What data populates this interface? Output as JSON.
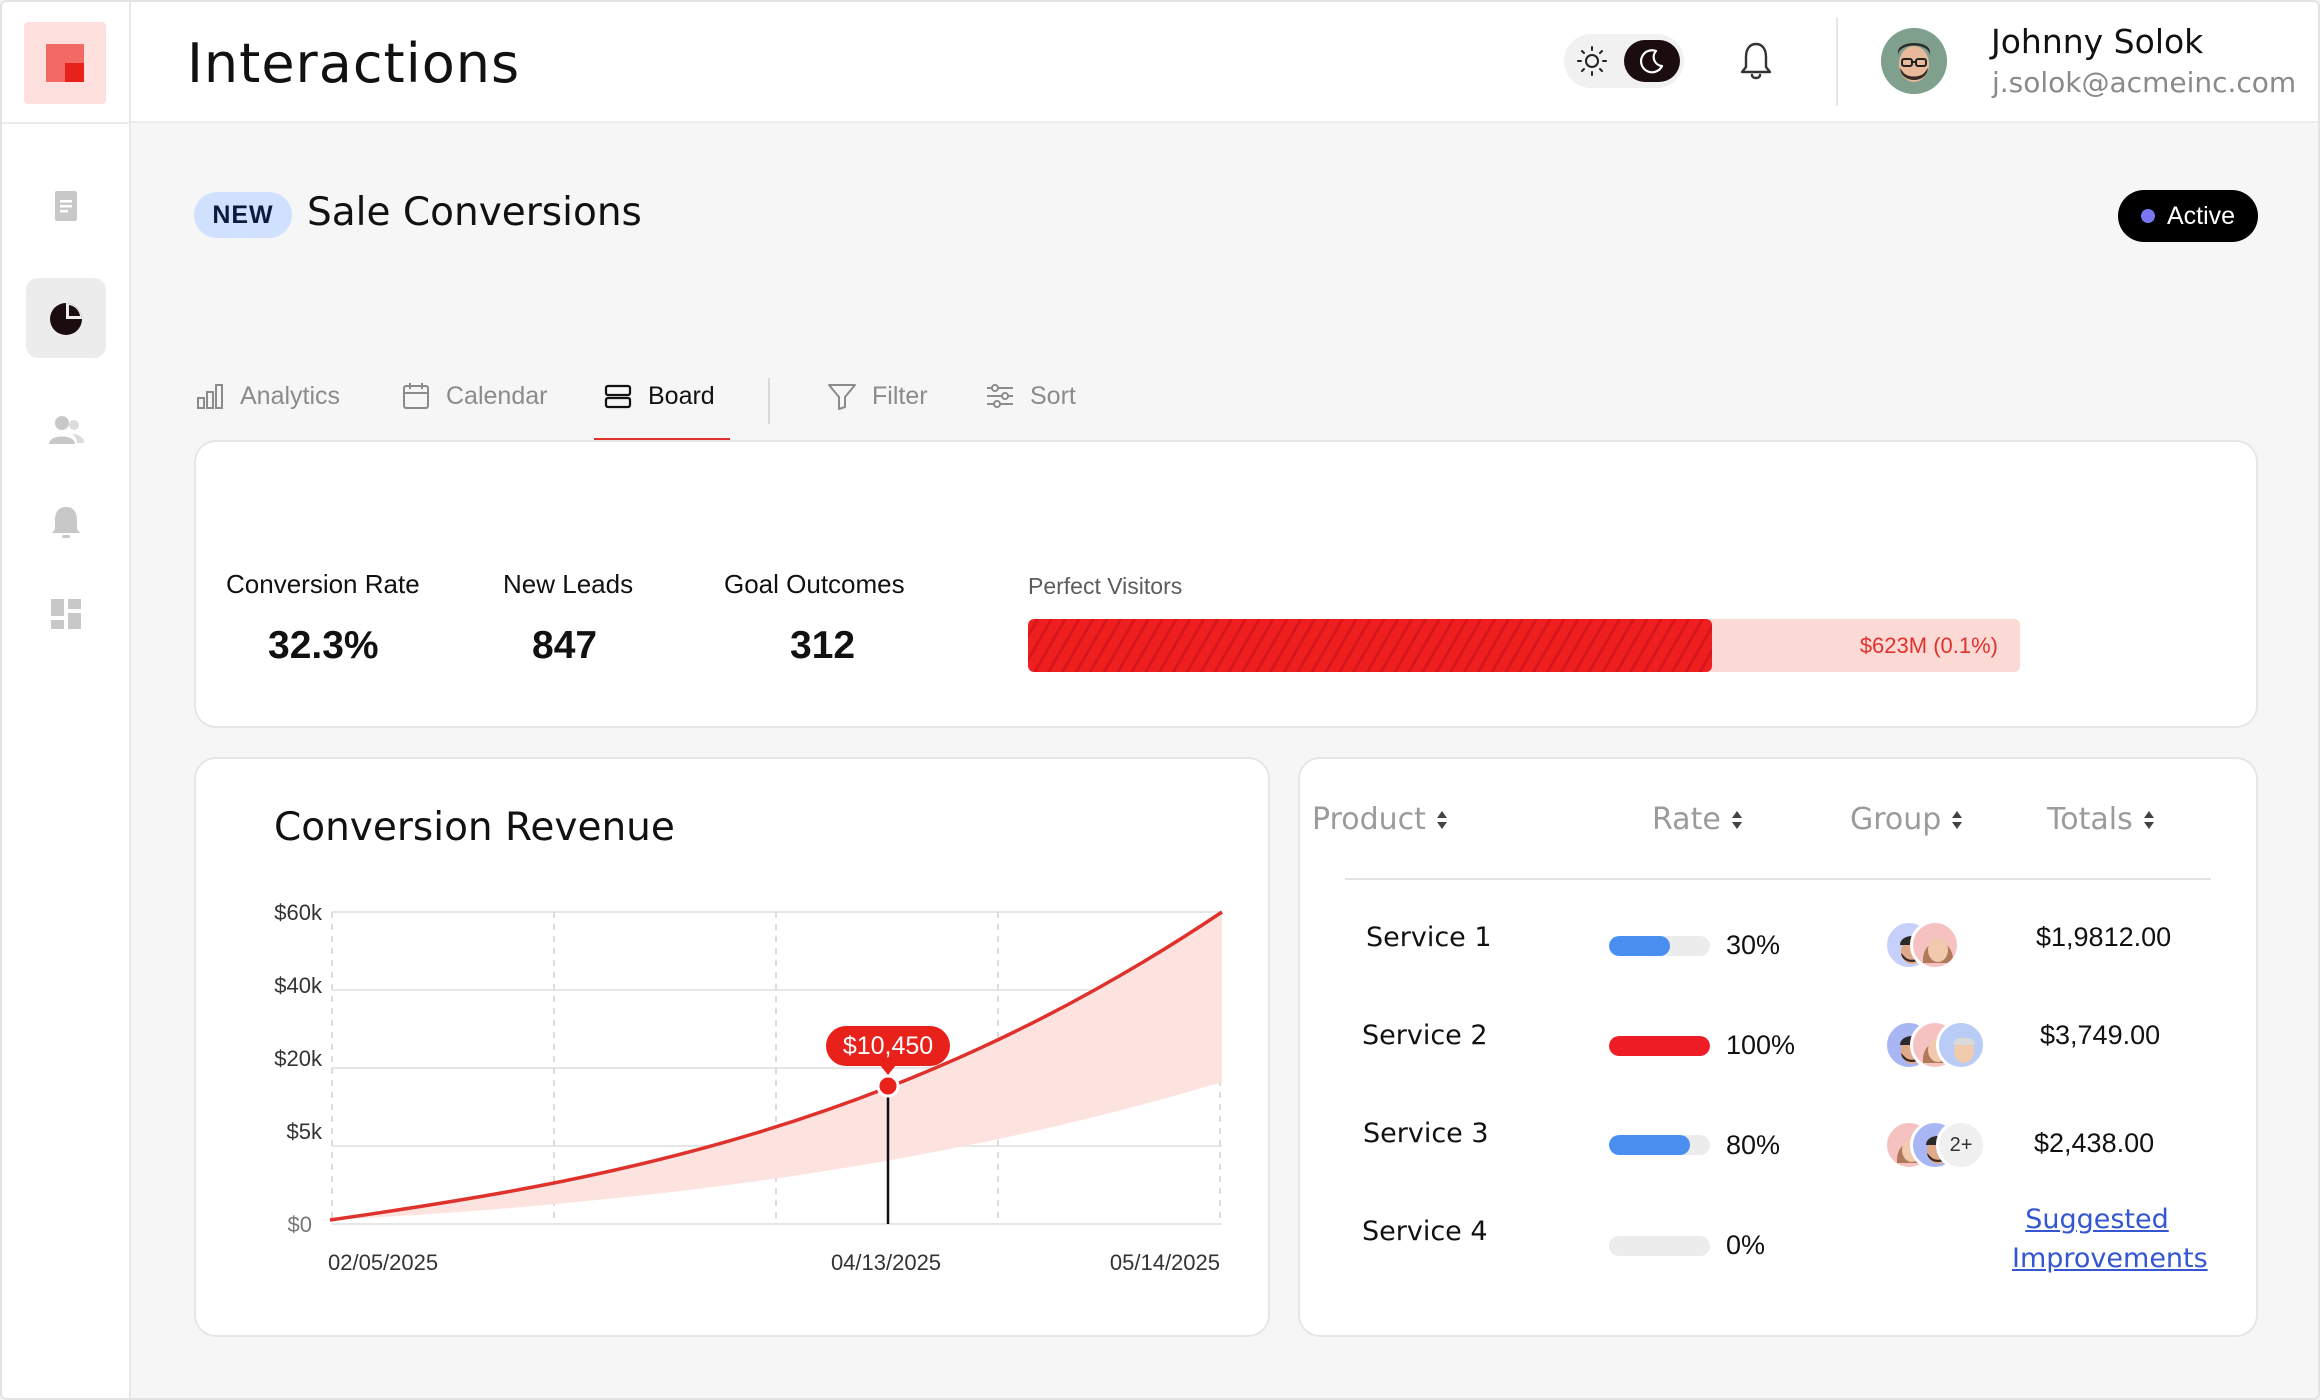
{
  "header": {
    "title": "Interactions",
    "user": {
      "name": "Johnny Solok",
      "email": "j.solok@acmeinc.com"
    }
  },
  "sidebar": {
    "items": [
      {
        "icon": "document-icon",
        "active": false
      },
      {
        "icon": "pie-chart-icon",
        "active": true
      },
      {
        "icon": "users-icon",
        "active": false
      },
      {
        "icon": "bell-icon",
        "active": false
      },
      {
        "icon": "dashboard-icon",
        "active": false
      }
    ]
  },
  "section": {
    "badge": "NEW",
    "title": "Sale Conversions",
    "status": "Active"
  },
  "tabs": [
    {
      "label": "Analytics",
      "icon": "bar-chart-icon"
    },
    {
      "label": "Calendar",
      "icon": "calendar-icon"
    },
    {
      "label": "Board",
      "icon": "board-icon",
      "active": true
    },
    {
      "label": "Filter",
      "icon": "filter-icon"
    },
    {
      "label": "Sort",
      "icon": "sliders-icon"
    }
  ],
  "stats": [
    {
      "label": "Conversion Rate",
      "value": "32.3%"
    },
    {
      "label": "New Leads",
      "value": "847"
    },
    {
      "label": "Goal Outcomes",
      "value": "312"
    }
  ],
  "perfect_visitors": {
    "label": "Perfect Visitors",
    "value_text": "$623M (0.1%)",
    "fill": 0.69
  },
  "chart": {
    "title": "Conversion Revenue",
    "tooltip": "$10,450"
  },
  "chart_data": {
    "type": "area",
    "title": "Conversion Revenue",
    "y_tick_labels": [
      "$60k",
      "$40k",
      "$20k",
      "$5k",
      "$0"
    ],
    "x_tick_labels": [
      "02/05/2025",
      "04/13/2025",
      "05/14/2025"
    ],
    "series": [
      {
        "values_note": "upper line",
        "x": [
          "02/05/2025",
          "04/13/2025",
          "05/14/2025"
        ],
        "y_level": [
          0,
          0.45,
          1.0
        ]
      },
      {
        "values_note": "lower band edge",
        "x": [
          "02/05/2025",
          "04/13/2025",
          "05/14/2025"
        ],
        "y_level": [
          0,
          0.2,
          0.45
        ]
      }
    ],
    "highlight": {
      "x": "04/13/2025",
      "label": "$10,450"
    },
    "grid": true
  },
  "table": {
    "columns": [
      "Product",
      "Rate",
      "Group",
      "Totals"
    ],
    "rows": [
      {
        "name": "Service 1",
        "rate": "30%",
        "rate_value": 0.6,
        "rate_color": "#4a8ef0",
        "total": "$1,9812.00",
        "group_more": ""
      },
      {
        "name": "Service 2",
        "rate": "100%",
        "rate_value": 1.0,
        "rate_color": "#ee1d25",
        "total": "$3,749.00",
        "group_more": ""
      },
      {
        "name": "Service 3",
        "rate": "80%",
        "rate_value": 0.8,
        "rate_color": "#4a8ef0",
        "total": "$2,438.00",
        "group_more": "2+"
      },
      {
        "name": "Service 4",
        "rate": "0%",
        "rate_value": 0,
        "rate_color": "#4a8ef0",
        "total": "",
        "group_more": ""
      }
    ],
    "suggest_link": "Suggested Improvements"
  },
  "colors": {
    "accent_red": "#e0322c",
    "bar_red": "#ee1d25",
    "bar_blue": "#4a8ef0",
    "badge_blue": "#cfe1ff",
    "status_dot": "#7877f5"
  }
}
